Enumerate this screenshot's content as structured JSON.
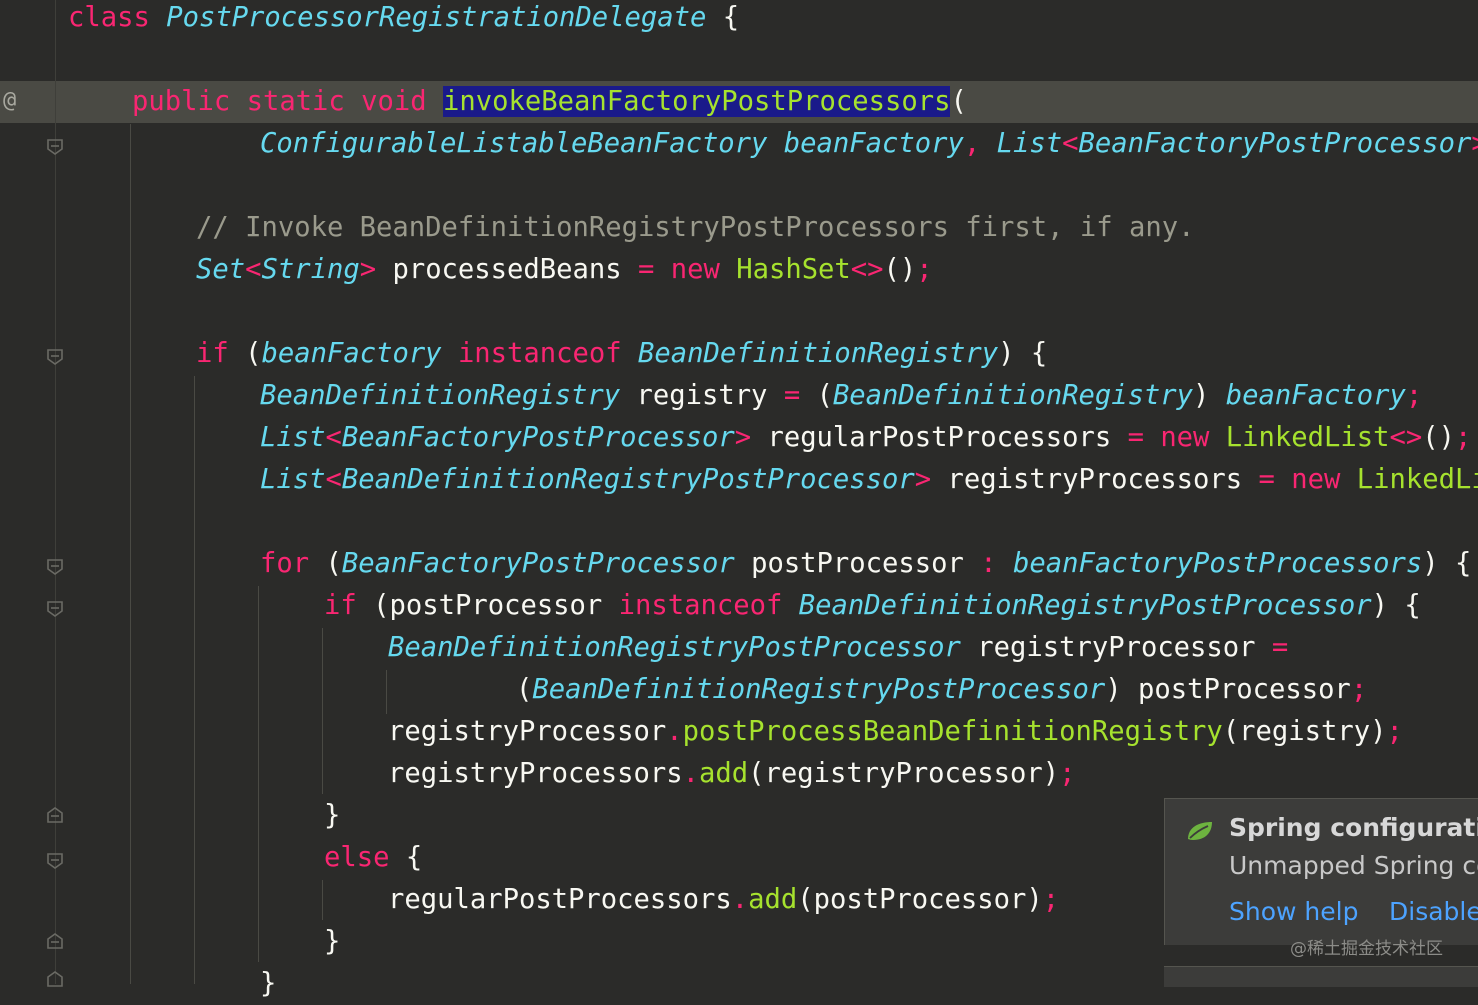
{
  "editor": {
    "gutter_marker": "@",
    "class_keyword": "class",
    "class_name": "PostProcessorRegistrationDelegate",
    "open_brace": "{",
    "method_modifiers": "public static void",
    "method_name": "invokeBeanFactoryPostProcessors",
    "paren_open": "(",
    "param_line": {
      "type1": "ConfigurableListableBeanFactory",
      "name1": "beanFactory",
      "comma": ",",
      "type2": "List",
      "generic2": "BeanFactoryPostProcessor"
    },
    "comment": "// Invoke BeanDefinitionRegistryPostProcessors first, if any.",
    "set_line": {
      "type": "Set",
      "generic": "String",
      "var": "processedBeans",
      "new": "new",
      "ctor": "HashSet"
    },
    "if1": {
      "kw": "if",
      "var": "beanFactory",
      "instanceof": "instanceof",
      "type": "BeanDefinitionRegistry"
    },
    "registry_line": {
      "type": "BeanDefinitionRegistry",
      "var": "registry",
      "cast": "BeanDefinitionRegistry",
      "src": "beanFactory"
    },
    "regular_line": {
      "type": "List",
      "generic": "BeanFactoryPostProcessor",
      "var": "regularPostProcessors",
      "new": "new",
      "ctor": "LinkedList"
    },
    "registryprocs_line": {
      "type": "List",
      "generic": "BeanDefinitionRegistryPostProcessor",
      "var": "registryProcessors",
      "new": "new",
      "ctor": "LinkedLis"
    },
    "for_line": {
      "kw": "for",
      "type": "BeanFactoryPostProcessor",
      "var": "postProcessor",
      "colon": ":",
      "src": "beanFactoryPostProcessors"
    },
    "if2": {
      "kw": "if",
      "var": "postProcessor",
      "instanceof": "instanceof",
      "type": "BeanDefinitionRegistryPostProcessor"
    },
    "decl_line": {
      "type": "BeanDefinitionRegistryPostProcessor",
      "var": "registryProcessor"
    },
    "cast_line": {
      "type": "BeanDefinitionRegistryPostProcessor",
      "var": "postProcessor"
    },
    "call1": {
      "target": "registryProcessor",
      "method": "postProcessBeanDefinitionRegistry",
      "arg": "registry"
    },
    "call2": {
      "target": "registryProcessors",
      "method": "add",
      "arg": "registryProcessor"
    },
    "else_kw": "else",
    "call3": {
      "target": "regularPostProcessors",
      "method": "add",
      "arg": "postProcessor"
    }
  },
  "notification": {
    "title": "Spring configuratio",
    "body": "Unmapped Spring co",
    "show_help": "Show help",
    "disable": "Disable",
    "icon": "spring-leaf-icon"
  },
  "watermark": "@稀土掘金技术社区",
  "colors": {
    "background": "#2b2b29",
    "keyword": "#f92672",
    "type": "#66d9ef",
    "function": "#a6e22e",
    "comment": "#9a9a8c",
    "selection": "#1a1a8a"
  }
}
